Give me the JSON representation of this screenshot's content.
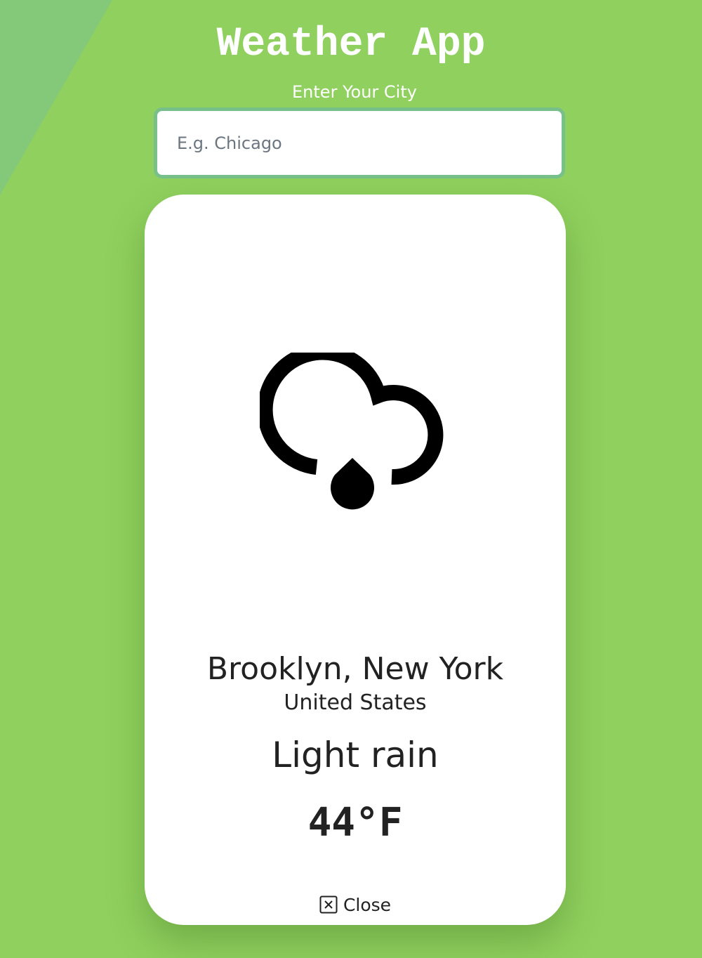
{
  "header": {
    "title": "Weather App",
    "input_label": "Enter Your City"
  },
  "search": {
    "value": "",
    "placeholder": "E.g. Chicago"
  },
  "weather": {
    "icon": "cloud-rain-icon",
    "city": "Brooklyn, New York",
    "country": "United States",
    "condition": "Light rain",
    "temperature": "44°F"
  },
  "card": {
    "close_label": "Close",
    "close_icon": "close-square-icon"
  },
  "colors": {
    "background": "#8fd05e",
    "corner_accent": "#84c97a",
    "input_border": "#77c08a",
    "card": "#ffffff",
    "text": "#222222"
  }
}
